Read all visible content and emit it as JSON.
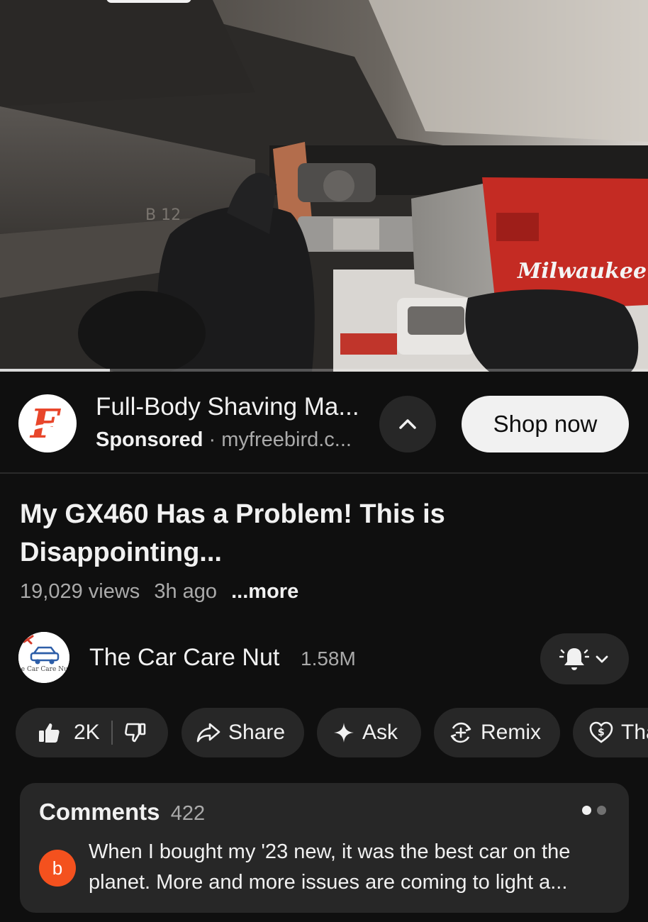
{
  "ad": {
    "logo_letter": "F",
    "title": "Full-Body Shaving Ma...",
    "sponsored": "Sponsored",
    "separator": "·",
    "domain": "myfreebird.c...",
    "cta": "Shop now",
    "collapse_icon": "chevron-up-icon"
  },
  "video": {
    "tool_brand": "Milwaukee",
    "plate_text": "B 12",
    "progress": 0.17,
    "title": "My GX460 Has a Problem! This is Disappointing...",
    "views": "19,029 views",
    "age": "3h ago",
    "more": "...more"
  },
  "channel": {
    "name": "The Car Care Nut",
    "subscribers": "1.58M",
    "avatar_text": "he Car Care Nu",
    "notification_icon": "bell-icon"
  },
  "actions": {
    "likes": "2K",
    "share": "Share",
    "ask": "Ask",
    "remix": "Remix",
    "thanks": "Tha"
  },
  "comments": {
    "label": "Comments",
    "count": "422",
    "top_comment": {
      "avatar_letter": "b",
      "text": "When I bought my '23 new, it was the best car on the planet.   More and more issues are coming to light a..."
    }
  },
  "colors": {
    "background": "#0f0f0f",
    "chip": "#272727",
    "brand_red": "#e8462b",
    "commenter_avatar": "#f4511e"
  }
}
